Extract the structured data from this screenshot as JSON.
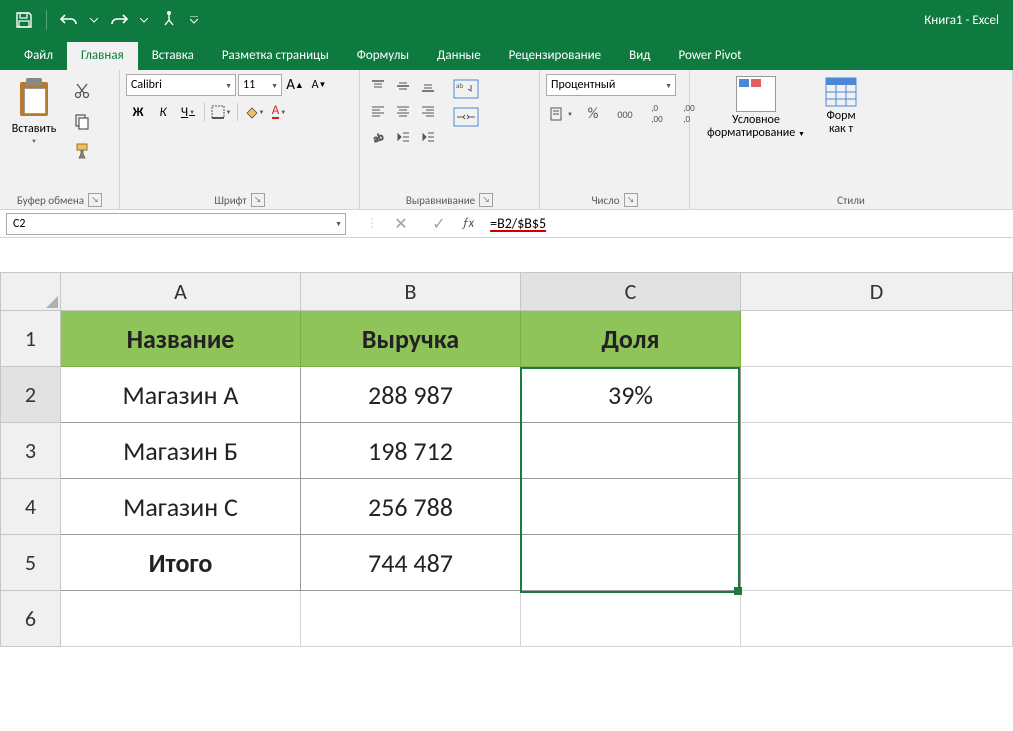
{
  "app_title": "Книга1 - Excel",
  "tabs": {
    "file": "Файл",
    "home": "Главная",
    "insert": "Вставка",
    "layout": "Разметка страницы",
    "formulas": "Формулы",
    "data": "Данные",
    "review": "Рецензирование",
    "view": "Вид",
    "powerpivot": "Power Pivot"
  },
  "ribbon": {
    "clipboard": {
      "paste": "Вставить",
      "label": "Буфер обмена"
    },
    "font": {
      "name": "Calibri",
      "size": "11",
      "label": "Шрифт",
      "bold": "Ж",
      "italic": "К",
      "underline": "Ч"
    },
    "alignment": {
      "label": "Выравнивание"
    },
    "number": {
      "format": "Процентный",
      "label": "Число",
      "pct": "%",
      "thou": "000"
    },
    "styles": {
      "cond1": "Условное",
      "cond2": "форматирование",
      "fmt1": "Форм",
      "fmt2": "как т",
      "label": "Стили"
    }
  },
  "namebox": "C2",
  "formula": "=B2/$B$5",
  "columns": [
    "A",
    "B",
    "C",
    "D"
  ],
  "rows": [
    "1",
    "2",
    "3",
    "4",
    "5",
    "6"
  ],
  "cells": {
    "A1": "Название",
    "B1": "Выручка",
    "C1": "Доля",
    "A2": "Магазин А",
    "B2": "288 987",
    "C2": "39%",
    "A3": "Магазин Б",
    "B3": "198 712",
    "A4": "Магазин С",
    "B4": "256 788",
    "A5": "Итого",
    "B5": "744 487"
  }
}
